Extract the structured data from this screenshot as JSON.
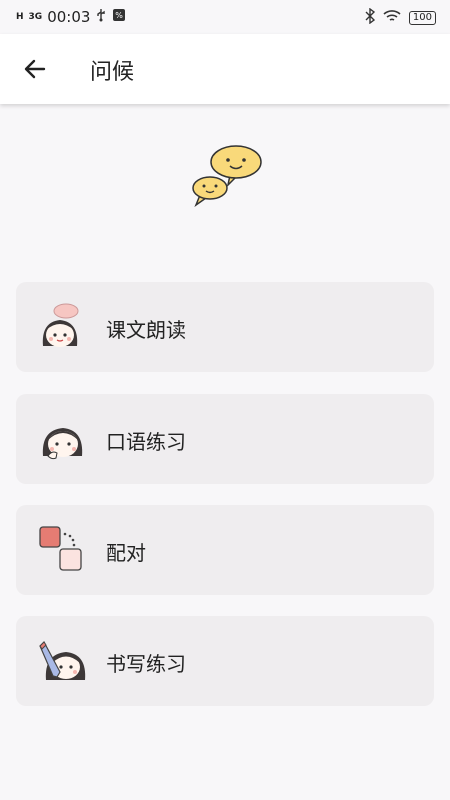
{
  "status_bar": {
    "network_h": "H",
    "network_3g": "3G",
    "time": "00:03",
    "usb_icon": "usb-icon",
    "sync_icon": "sync-icon",
    "bluetooth_icon": "bluetooth-icon",
    "wifi_icon": "wifi-icon",
    "battery_level": "100"
  },
  "header": {
    "back_icon": "arrow-left-icon",
    "title": "问候"
  },
  "hero": {
    "icon": "chat-bubbles-icon"
  },
  "menu": {
    "items": [
      {
        "label": "课文朗读",
        "icon": "girl-speech-bubble-icon"
      },
      {
        "label": "口语练习",
        "icon": "girl-hand-icon"
      },
      {
        "label": "配对",
        "icon": "matching-squares-icon"
      },
      {
        "label": "书写练习",
        "icon": "girl-pencil-icon"
      }
    ]
  },
  "colors": {
    "background": "#f8f7f9",
    "card": "#efedef",
    "bubble_yellow": "#f9d97a",
    "match_red": "#e57c73",
    "match_pink": "#fbe3e0"
  }
}
